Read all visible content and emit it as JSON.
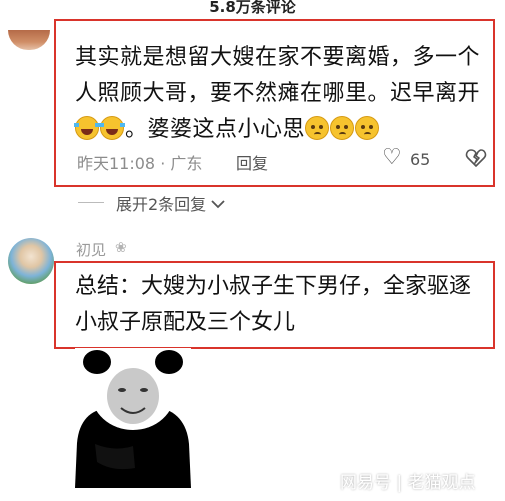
{
  "header": {
    "title": "5.8万条评论"
  },
  "comment1": {
    "line1": "其实就是想留大嫂在家不要离婚，多一个",
    "line2": "人照顾大哥，要不然瘫在哪里。迟早离开",
    "line3": "。婆婆这点小心思",
    "time": "昨天11:08 · 广东",
    "reply_label": "回复",
    "likes": "65"
  },
  "expand": {
    "label": "展开2条回复"
  },
  "comment2": {
    "username": "初见",
    "line1": "总结：大嫂为小叔子生下男仔，全家驱逐",
    "line2": "小叔子原配及三个女儿"
  },
  "watermark": {
    "text": "网易号 | 老猫观点"
  },
  "icons": {
    "heart": "heart-icon",
    "broken_heart": "broken-heart-icon",
    "chevron": "chevron-down-icon",
    "emoji_laugh": "laugh-cry-emoji",
    "emoji_worry": "worried-emoji"
  },
  "colors": {
    "highlight_border": "#d9342b"
  }
}
